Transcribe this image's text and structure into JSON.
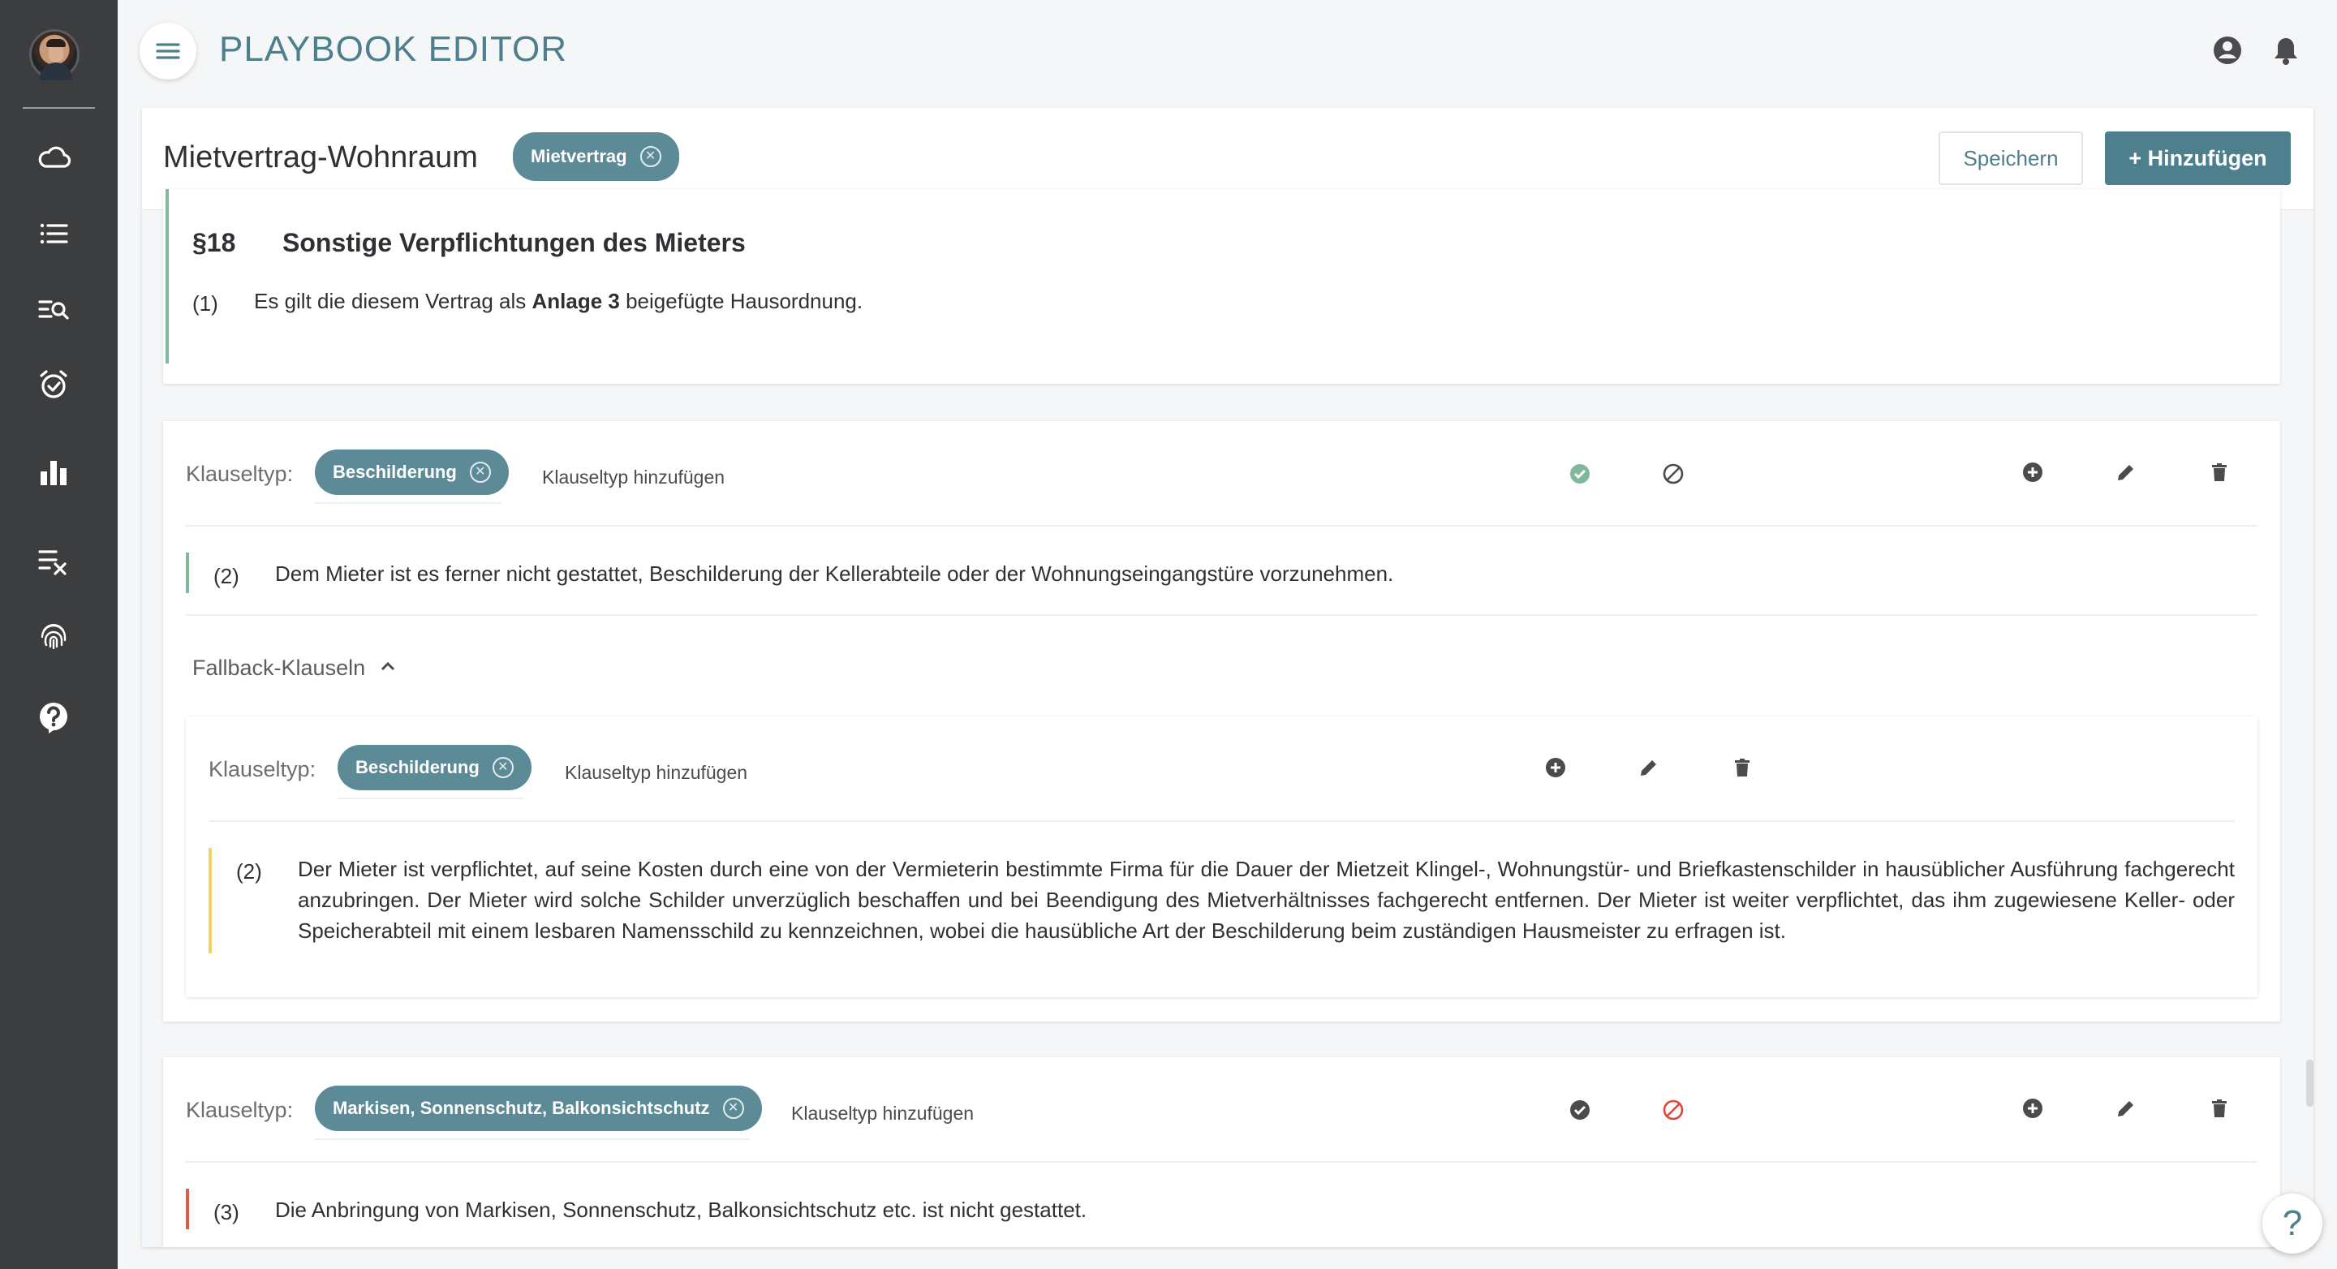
{
  "app": {
    "title": "PLAYBOOK EDITOR"
  },
  "sidebar": {
    "items": [
      {
        "icon": "cloud-icon"
      },
      {
        "icon": "list-icon"
      },
      {
        "icon": "list-search-icon"
      },
      {
        "icon": "alarm-check-icon"
      },
      {
        "icon": "bar-chart-icon"
      },
      {
        "icon": "list-check-icon"
      },
      {
        "icon": "fingerprint-icon"
      },
      {
        "icon": "help-circle-icon"
      }
    ]
  },
  "document": {
    "title": "Mietvertrag-Wohnraum",
    "tag": "Mietvertrag",
    "save_label": "Speichern",
    "add_label": "+ Hinzufügen"
  },
  "section18": {
    "number": "§18",
    "title": "Sonstige Verpflichtungen des Mieters",
    "para_num": "(1)",
    "text_before": "Es gilt die diesem Vertrag als ",
    "text_bold": "Anlage 3",
    "text_after": " beigefügte Hausordnung."
  },
  "clause1": {
    "label": "Klauseltyp:",
    "tag": "Beschilderung",
    "add_type": "Klauseltyp hinzufügen",
    "para_num": "(2)",
    "text": "Dem Mieter ist es ferner nicht gestattet, Beschilderung der Kellerabteile oder der Wohnungseingangstüre vorzunehmen.",
    "accent": "#7fb89a"
  },
  "fallback": {
    "label": "Fallback-Klauseln",
    "clause": {
      "label": "Klauseltyp:",
      "tag": "Beschilderung",
      "add_type": "Klauseltyp hinzufügen",
      "para_num": "(2)",
      "text": "Der Mieter ist verpflichtet, auf seine Kosten durch eine von der Vermieterin bestimmte Firma für die Dauer der Mietzeit Klingel-, Wohnungstür- und Briefkastenschilder in hausüblicher Ausführung fachgerecht anzubringen. Der Mieter wird solche Schilder unverzüglich beschaffen und bei Beendigung des Mietverhältnisses fachgerecht entfernen. Der Mieter ist weiter verpflichtet, das ihm zugewiesene Keller- oder Speicherabteil mit einem lesbaren Namensschild zu kennzeichnen, wobei die hausübliche Art der Beschilderung beim zuständigen Hausmeister zu erfragen ist.",
      "accent": "#f0d264"
    }
  },
  "clause2": {
    "label": "Klauseltyp:",
    "tag": "Markisen, Sonnenschutz, Balkonsichtschutz",
    "add_type": "Klauseltyp hinzufügen",
    "para_num": "(3)",
    "text": "Die Anbringung von Markisen, Sonnenschutz, Balkonsichtschutz etc. ist nicht gestattet.",
    "accent": "#e05a4a"
  },
  "help": {
    "label": "?"
  },
  "colors": {
    "accent": "#4d7f8c",
    "chip": "#5c8a96",
    "sidebar": "#3c3d3e",
    "approve_green": "#7fb89a",
    "reject_red": "#e0473a"
  }
}
